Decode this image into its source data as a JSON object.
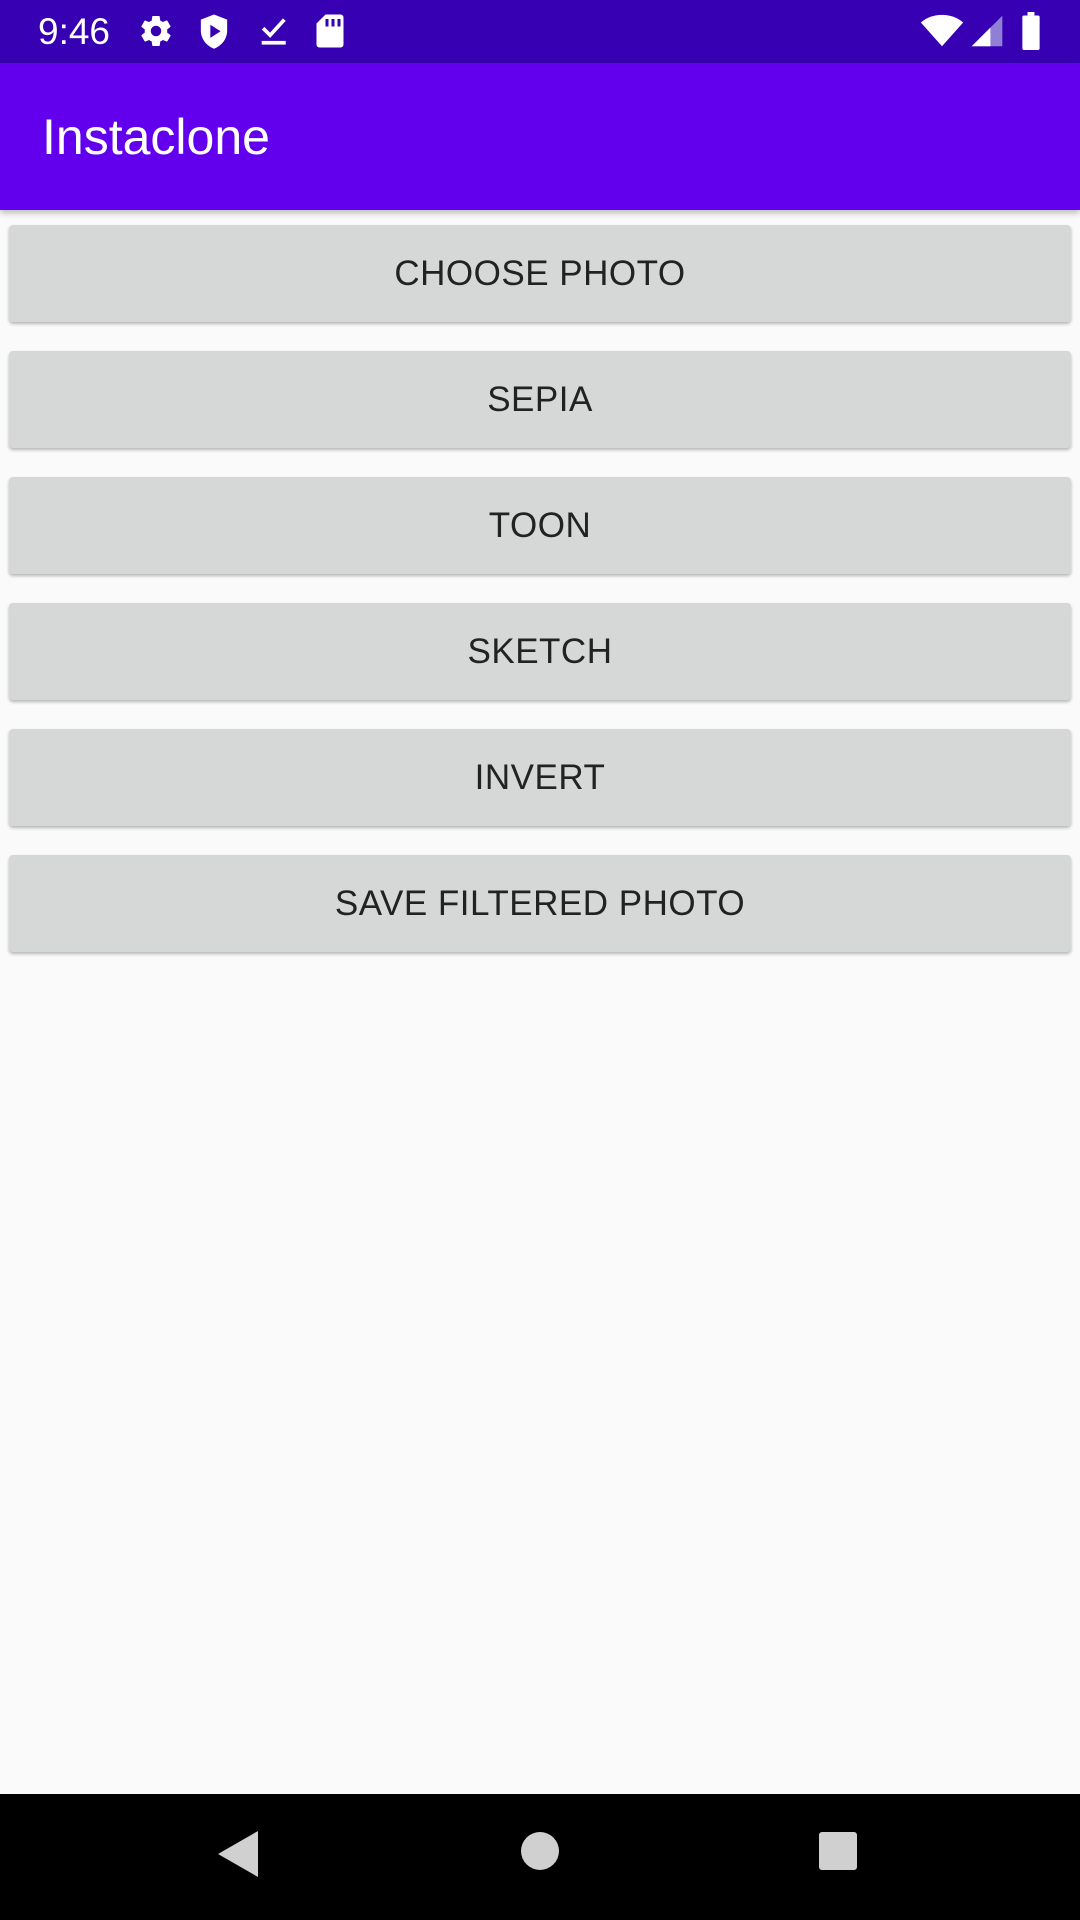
{
  "status_bar": {
    "time": "9:46",
    "left_icons": [
      "gear-icon",
      "shield-play-icon",
      "download-done-icon",
      "sd-card-icon"
    ],
    "right_icons": [
      "wifi-icon",
      "cell-signal-icon",
      "battery-icon"
    ]
  },
  "app_bar": {
    "title": "Instaclone",
    "color": "#6200ee"
  },
  "buttons": [
    {
      "label": "CHOOSE PHOTO"
    },
    {
      "label": "SEPIA"
    },
    {
      "label": "TOON"
    },
    {
      "label": "SKETCH"
    },
    {
      "label": "INVERT"
    },
    {
      "label": "SAVE FILTERED PHOTO"
    }
  ],
  "nav_bar": {
    "icons": [
      "back-icon",
      "home-icon",
      "recents-icon"
    ]
  },
  "colors": {
    "status_bar": "#3700b3",
    "primary": "#6200ee",
    "button_bg": "#d6d7d7",
    "background": "#fafafa"
  }
}
